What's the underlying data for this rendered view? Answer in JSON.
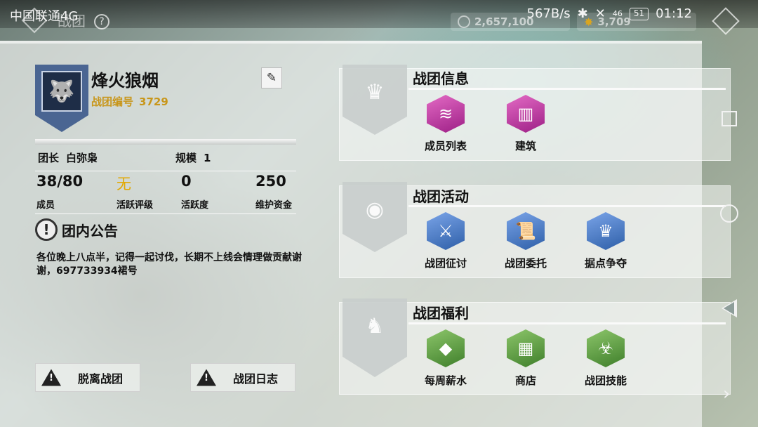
{
  "status_bar": {
    "carrier": "中国联通4G",
    "speed": "567B/s",
    "signal": "46",
    "battery": "51",
    "time": "01:12"
  },
  "header": {
    "title": "战团",
    "currency_a": "2,657,100",
    "currency_b": "3,709"
  },
  "guild": {
    "name": "烽火狼烟",
    "id_label": "战团编号",
    "id_value": "3729",
    "leader_label": "团长",
    "leader_value": "白弥枭",
    "scale_label": "规模",
    "scale_value": "1",
    "stats": [
      {
        "value": "38/80",
        "label": "成员"
      },
      {
        "value": "无",
        "label": "活跃评级"
      },
      {
        "value": "0",
        "label": "活跃度"
      },
      {
        "value": "250",
        "label": "维护资金"
      }
    ],
    "notice_icon": "!",
    "notice_title": "团内公告",
    "notice_text": "各位晚上八点半，记得一起讨伐，长期不上线会情理做贡献谢谢，697733934裙号"
  },
  "buttons": {
    "leave": "脱离战团",
    "log": "战团日志"
  },
  "sections": {
    "info": {
      "title": "战团信息",
      "items": [
        {
          "label": "成员列表",
          "icon": "member-list-icon"
        },
        {
          "label": "建筑",
          "icon": "building-icon"
        }
      ]
    },
    "activity": {
      "title": "战团活动",
      "items": [
        {
          "label": "战团征讨",
          "icon": "crossed-swords-icon"
        },
        {
          "label": "战团委托",
          "icon": "scroll-icon"
        },
        {
          "label": "据点争夺",
          "icon": "crown-icon"
        }
      ]
    },
    "welfare": {
      "title": "战团福利",
      "items": [
        {
          "label": "每周薪水",
          "icon": "diamond-icon"
        },
        {
          "label": "商店",
          "icon": "shop-icon"
        },
        {
          "label": "战团技能",
          "icon": "biohazard-icon"
        }
      ]
    }
  },
  "colors": {
    "gold": "#e2a800",
    "guild_id": "#c8961a",
    "emblem": "#4a6592",
    "magenta_tile": "#c13aa6",
    "blue_tile": "#4f7fcc",
    "green_tile": "#5f9e40"
  }
}
